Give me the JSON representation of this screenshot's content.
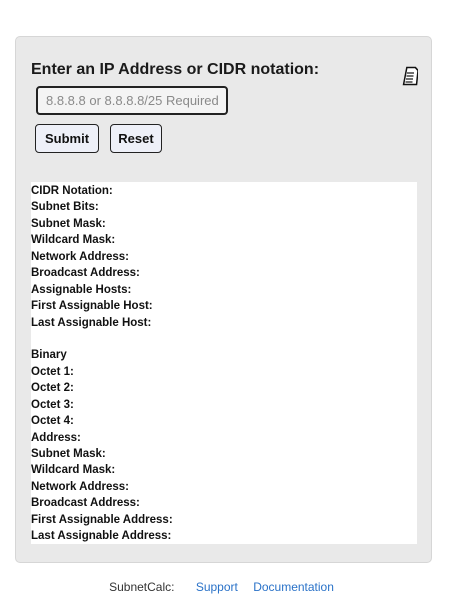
{
  "form": {
    "heading": "Enter an IP Address or CIDR notation:",
    "input_placeholder": "8.8.8.8 or 8.8.8.8/25 Required",
    "input_value": "",
    "submit_label": "Submit",
    "reset_label": "Reset",
    "doc_icon": "document-icon"
  },
  "results": {
    "summary": [
      "CIDR Notation:",
      "Subnet Bits:",
      "Subnet Mask:",
      "Wildcard Mask:",
      "Network Address:",
      "Broadcast Address:",
      "Assignable Hosts:",
      "First Assignable Host:",
      "Last Assignable Host:"
    ],
    "binary_heading": "Binary",
    "binary": [
      "Octet 1:",
      "Octet 2:",
      "Octet 3:",
      "Octet 4:",
      "Address:",
      "Subnet Mask:",
      "Wildcard Mask:",
      "Network Address:",
      "Broadcast Address:",
      "First Assignable Address:",
      "Last Assignable Address:"
    ]
  },
  "footer": {
    "brand": "SubnetCalc:",
    "links": [
      "Support",
      "Documentation"
    ]
  }
}
